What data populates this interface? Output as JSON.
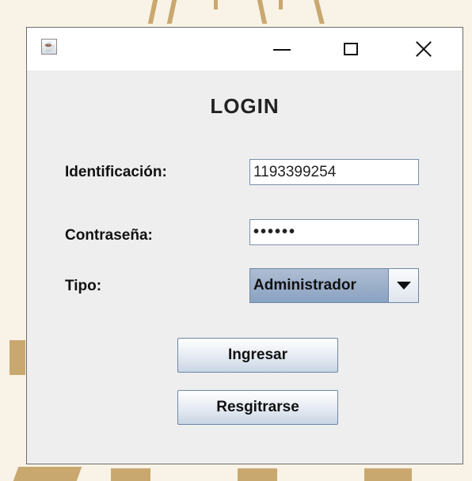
{
  "window": {
    "app_icon": "java-coffee-icon",
    "controls": {
      "minimize": "minimize-icon",
      "maximize": "maximize-icon",
      "close": "close-icon"
    }
  },
  "form": {
    "title": "LOGIN",
    "identificacion_label": "Identificación:",
    "identificacion_value": "1193399254",
    "contrasena_label": "Contraseña:",
    "contrasena_value": "••••••",
    "tipo_label": "Tipo:",
    "tipo_selected": "Administrador",
    "ingresar_label": "Ingresar",
    "registrarse_label": "Resgitrarse"
  },
  "colors": {
    "window_bg": "#eeeeee",
    "titlebar_bg": "#ffffff",
    "select_accent": "#8aa2c2",
    "background_gold": "#c9a870"
  }
}
